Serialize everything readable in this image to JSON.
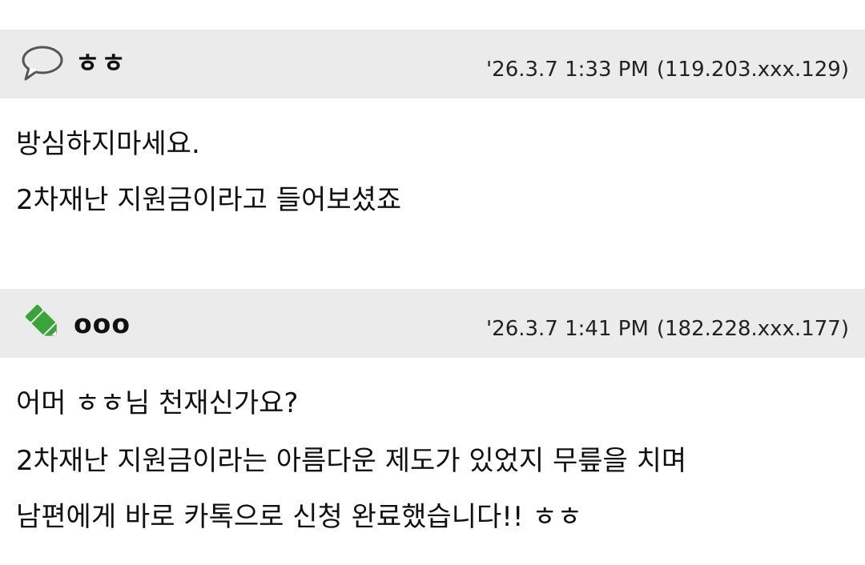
{
  "comments": [
    {
      "author": "ㅎㅎ",
      "avatar_icon": "speech-bubble-icon",
      "date": "'26.3.7 1:33 PM",
      "ip": "(119.203.xxx.129)",
      "lines": [
        "방심하지마세요.",
        "2차재난 지원금이라고 들어보셨죠"
      ]
    },
    {
      "author": "ooo",
      "avatar_icon": "pencil-icon",
      "date": "'26.3.7 1:41 PM",
      "ip": "(182.228.xxx.177)",
      "lines": [
        "어머 ㅎㅎ님 천재신가요?",
        "2차재난 지원금이라는 아름다운 제도가 있었지 무릎을 치며",
        "남편에게 바로 카톡으로 신청 완료했습니다!! ㅎㅎ"
      ]
    }
  ],
  "colors": {
    "header_bg": "#ebebeb",
    "pencil_green": "#3aa33a"
  }
}
